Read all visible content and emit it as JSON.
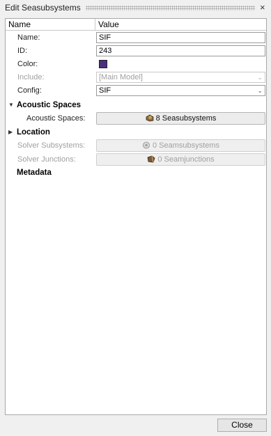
{
  "window": {
    "title": "Edit Seasubsystems",
    "close_glyph": "×"
  },
  "table": {
    "headers": {
      "name": "Name",
      "value": "Value"
    },
    "rows": {
      "name": {
        "label": "Name:",
        "value": "SIF"
      },
      "id": {
        "label": "ID:",
        "value": "243"
      },
      "color": {
        "label": "Color:",
        "swatch": "#4b2e7e"
      },
      "include": {
        "label": "Include:",
        "value": "[Main Model]"
      },
      "config": {
        "label": "Config:",
        "value": "SIF"
      }
    },
    "sections": {
      "acoustic": {
        "label": "Acoustic Spaces",
        "expander": "▼"
      },
      "location": {
        "label": "Location",
        "expander": "▶"
      },
      "metadata": {
        "label": "Metadata"
      }
    },
    "acoustic_spaces": {
      "label": "Acoustic Spaces:",
      "button": "8 Seasubsystems",
      "icon": "seasubsystem-icon"
    },
    "solver_subsystems": {
      "label": "Solver Subsystems:",
      "button": "0 Seamsubsystems",
      "icon": "seamsubsystem-icon"
    },
    "solver_junctions": {
      "label": "Solver Junctions:",
      "button": "0 Seamjunctions",
      "icon": "seamjunction-icon"
    },
    "dropdown_arrow": "⌄"
  },
  "footer": {
    "close_label": "Close"
  }
}
